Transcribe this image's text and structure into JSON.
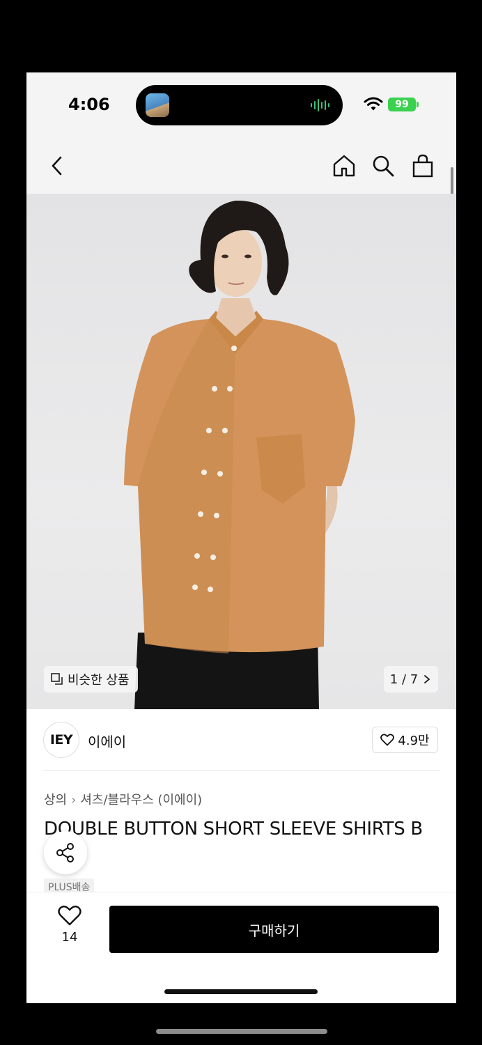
{
  "status_bar": {
    "time": "4:06",
    "battery": "99"
  },
  "nav": {
    "back_icon": "chevron-left-icon",
    "home_icon": "home-icon",
    "search_icon": "search-icon",
    "cart_icon": "shopping-bag-icon"
  },
  "photo": {
    "similar_label": "비슷한 상품",
    "counter": "1 / 7",
    "counter_icon": "chevron-right-icon"
  },
  "brand": {
    "logo_text": "IEY",
    "name": "이에이",
    "likes": "4.9만"
  },
  "product": {
    "breadcrumb": [
      "상의",
      "셔츠/블라우스 (이에이)"
    ],
    "title": "DOUBLE BUTTON SHORT SLEEVE SHIRTS B",
    "badge": "PLUS배송"
  },
  "bottom": {
    "wish_count": "14",
    "buy_label": "구매하기"
  },
  "colors": {
    "accent": "#000000",
    "battery": "#3ad14e",
    "shirt": "#d3935a"
  }
}
